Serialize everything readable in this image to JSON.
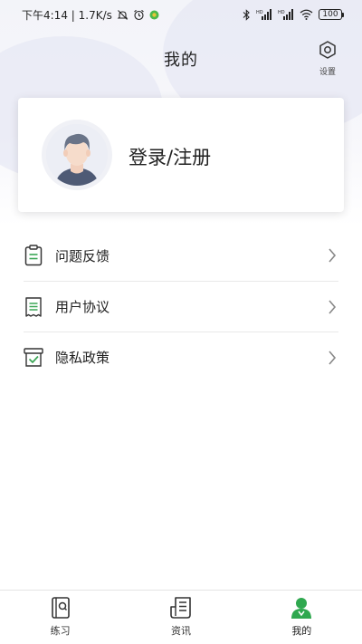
{
  "status_bar": {
    "time_speed": "下午4:14 | 1.7K/s",
    "battery": "100"
  },
  "header": {
    "title": "我的",
    "settings_label": "设置"
  },
  "profile": {
    "login_label": "登录/注册"
  },
  "menu": {
    "items": [
      {
        "label": "问题反馈",
        "icon": "clipboard-icon"
      },
      {
        "label": "用户协议",
        "icon": "receipt-icon"
      },
      {
        "label": "隐私政策",
        "icon": "shield-check-icon"
      }
    ]
  },
  "tabbar": {
    "items": [
      {
        "label": "练习",
        "icon": "book-icon"
      },
      {
        "label": "资讯",
        "icon": "news-icon"
      },
      {
        "label": "我的",
        "icon": "person-icon",
        "active": true
      }
    ]
  },
  "colors": {
    "accent": "#2fa84f",
    "icon_green": "#3aa655",
    "text": "#222222",
    "divider": "#e8e8e8"
  }
}
